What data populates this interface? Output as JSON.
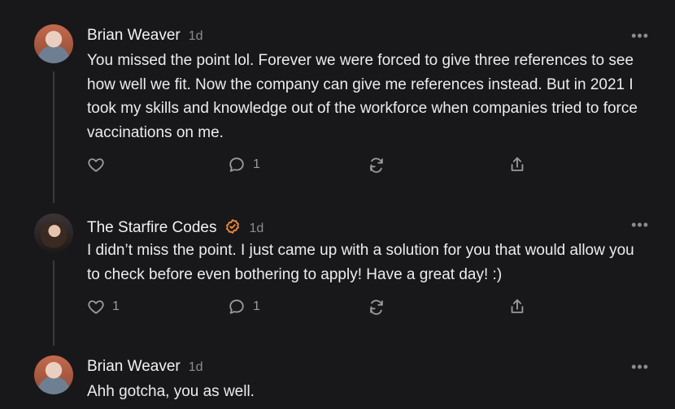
{
  "comments": [
    {
      "author": "Brian Weaver",
      "time": "1d",
      "text": "You missed the point lol. Forever we were forced to give three references to see how well we fit. Now the company can give me references instead. But in 2021 I took my skills and knowledge out of the workforce when companies tried to force vaccinations on me.",
      "like_count": "",
      "reply_count": "1"
    },
    {
      "author": "The Starfire Codes",
      "time": "1d",
      "text": "I didn’t miss the point. I just came up with a solution for you that would allow you to check before even bothering to apply! Have a great day! :)",
      "like_count": "1",
      "reply_count": "1",
      "verified_color": "#f28b35"
    },
    {
      "author": "Brian Weaver",
      "time": "1d",
      "text": "Ahh gotcha, you as well."
    }
  ],
  "more_label": "•••"
}
